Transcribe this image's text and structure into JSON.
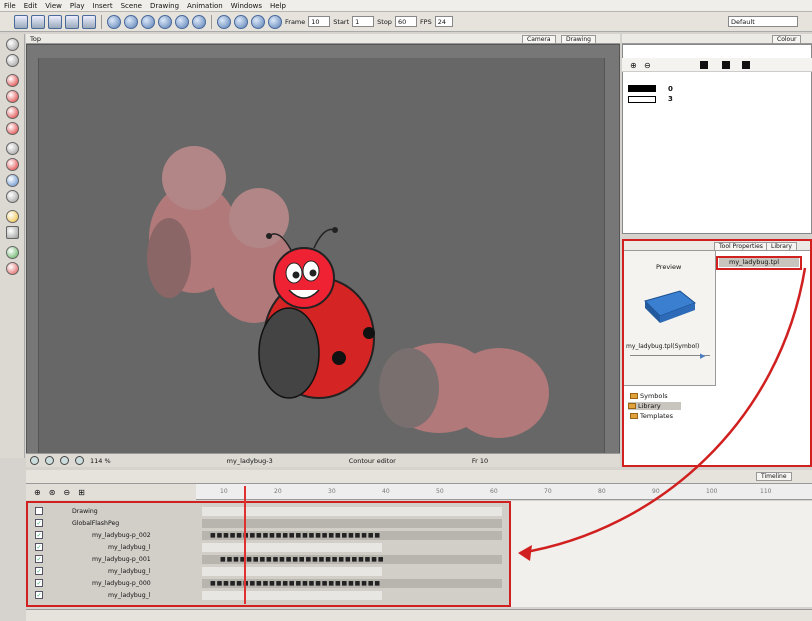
{
  "menu": [
    "File",
    "Edit",
    "View",
    "Play",
    "Insert",
    "Scene",
    "Drawing",
    "Animation",
    "Windows",
    "Help"
  ],
  "toolbar": {
    "frame_label": "Frame",
    "frame_value": "10",
    "start_label": "Start",
    "start_value": "1",
    "stop_label": "Stop",
    "stop_value": "60",
    "fps_label": "FPS",
    "fps_value": "24",
    "default_value": "Default"
  },
  "camera": {
    "view_title": "Top",
    "tab_camera": "Camera",
    "tab_drawing": "Drawing"
  },
  "status": {
    "zoom": "114 %",
    "drawing_name": "my_ladybug-3",
    "mode": "Contour editor",
    "frame": "Fr 10"
  },
  "colour_panel": {
    "tab": "Colour",
    "swatch1_label": "0",
    "swatch2_label": "3"
  },
  "library_panel": {
    "tab_tool_properties": "Tool Properties",
    "tab_library": "Library",
    "preview_label": "Preview",
    "symbol_caption": "my_ladybug.tpl(Symbol)",
    "selected_item": "my_ladybug.tpl",
    "tree": [
      "Symbols",
      "Library",
      "Templates"
    ]
  },
  "timeline": {
    "tab": "Timeline",
    "ruler_ticks": [
      "10",
      "20",
      "30",
      "40",
      "50",
      "60",
      "70",
      "80",
      "90",
      "100",
      "110"
    ],
    "layers": [
      {
        "name": "Drawing"
      },
      {
        "name": "GlobalFlashPeg"
      },
      {
        "name": "my_ladybug-p_002"
      },
      {
        "name": "my_ladybug_l"
      },
      {
        "name": "my_ladybug-p_001"
      },
      {
        "name": "my_ladybug_l"
      },
      {
        "name": "my_ladybug-p_000"
      },
      {
        "name": "my_ladybug_l"
      }
    ]
  },
  "colors": {
    "highlight_red": "#d02020",
    "panel_gray": "#d6d3ce",
    "viewport": "#676767"
  }
}
